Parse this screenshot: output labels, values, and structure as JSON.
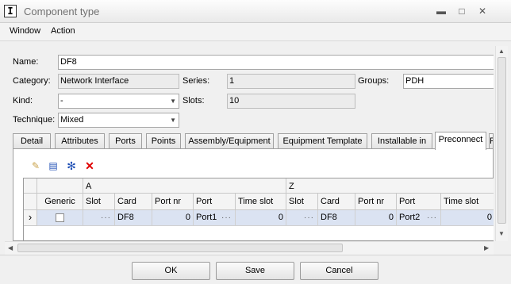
{
  "window": {
    "title": "Component type",
    "app_icon_glyph": "I",
    "controls": {
      "close": "✕",
      "maximize": "□",
      "minimize": "▬"
    }
  },
  "menu": [
    "Window",
    "Action"
  ],
  "form": {
    "name": {
      "label": "Name:",
      "value": "DF8"
    },
    "category": {
      "label": "Category:",
      "value": "Network Interface"
    },
    "series": {
      "label": "Series:",
      "value": "1"
    },
    "groups": {
      "label": "Groups:",
      "value": "PDH"
    },
    "kind": {
      "label": "Kind:",
      "value": "-"
    },
    "slots": {
      "label": "Slots:",
      "value": "10"
    },
    "technique": {
      "label": "Technique:",
      "value": "Mixed"
    }
  },
  "tabs": [
    "Detail",
    "Attributes",
    "Ports",
    "Points",
    "Assembly/Equipment",
    "Equipment Template",
    "Installable in",
    "Preconnect",
    "F"
  ],
  "active_tab": "Preconnect",
  "toolbar_icons": [
    "edit-icon",
    "table-icon",
    "asterisk-icon",
    "delete-icon"
  ],
  "grid": {
    "group_a": "A",
    "group_z": "Z",
    "columns": [
      "Generic",
      "Slot",
      "Card",
      "Port nr",
      "Port",
      "Time slot",
      "Slot",
      "Card",
      "Port nr",
      "Port",
      "Time slot"
    ],
    "rows": [
      {
        "indicator": "›",
        "slot_a": "",
        "card_a": "DF8",
        "port_nr_a": "0",
        "port_a": "Port1",
        "time_slot_a": "0",
        "slot_z": "",
        "card_z": "DF8",
        "port_nr_z": "0",
        "port_z": "Port2",
        "time_slot_z": "0",
        "ellipsis": "···"
      }
    ]
  },
  "buttons": {
    "ok": "OK",
    "save": "Save",
    "cancel": "Cancel"
  },
  "colors": {
    "selected_row": "#dbe3f2",
    "delete_red": "#e00000",
    "asterisk_blue": "#1f4fb5"
  }
}
